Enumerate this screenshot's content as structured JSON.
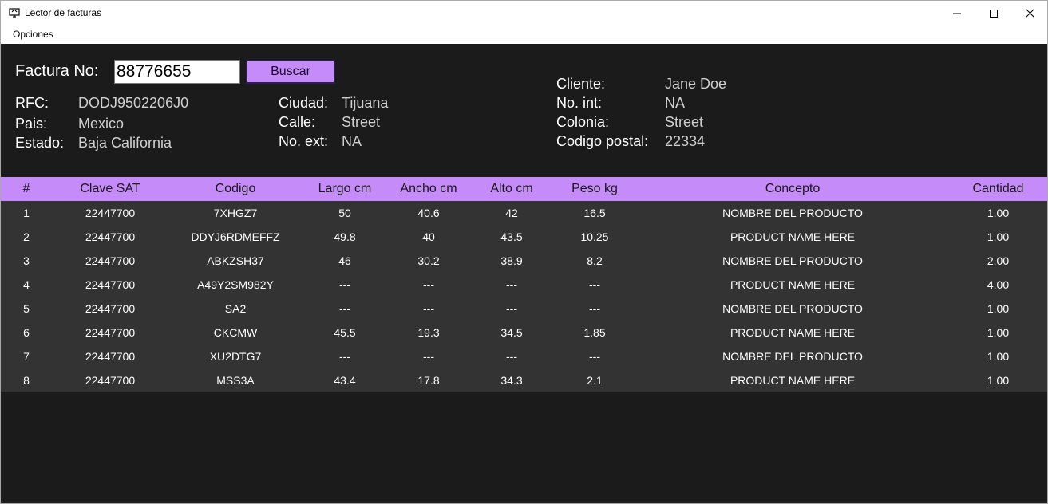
{
  "window": {
    "title": "Lector de facturas",
    "controls": {
      "minimize": "minimize-icon",
      "maximize": "maximize-icon",
      "close": "close-icon"
    }
  },
  "menu": {
    "items": [
      "Opciones"
    ]
  },
  "search": {
    "label": "Factura No:",
    "value": "88776655",
    "button_label": "Buscar"
  },
  "invoice": {
    "rfc_label": "RFC:",
    "rfc": "DODJ9502206J0",
    "pais_label": "Pais:",
    "pais": "Mexico",
    "estado_label": "Estado:",
    "estado": "Baja California",
    "ciudad_label": "Ciudad:",
    "ciudad": "Tijuana",
    "calle_label": "Calle:",
    "calle": "Street",
    "no_ext_label": "No. ext:",
    "no_ext": "NA",
    "cliente_label": "Cliente:",
    "cliente": "Jane Doe",
    "no_int_label": "No. int:",
    "no_int": "NA",
    "colonia_label": "Colonia:",
    "colonia": "Street",
    "cp_label": "Codigo postal:",
    "cp": "22334"
  },
  "table": {
    "columns": [
      "#",
      "Clave SAT",
      "Codigo",
      "Largo cm",
      "Ancho cm",
      "Alto cm",
      "Peso kg",
      "Concepto",
      "Cantidad"
    ],
    "rows": [
      [
        "1",
        "22447700",
        "7XHGZ7",
        "50",
        "40.6",
        "42",
        "16.5",
        "NOMBRE DEL PRODUCTO",
        "1.00"
      ],
      [
        "2",
        "22447700",
        "DDYJ6RDMEFFZ",
        "49.8",
        "40",
        "43.5",
        "10.25",
        "PRODUCT NAME HERE",
        "1.00"
      ],
      [
        "3",
        "22447700",
        "ABKZSH37",
        "46",
        "30.2",
        "38.9",
        "8.2",
        "NOMBRE DEL PRODUCTO",
        "2.00"
      ],
      [
        "4",
        "22447700",
        "A49Y2SM982Y",
        "---",
        "---",
        "---",
        "---",
        "PRODUCT NAME HERE",
        "4.00"
      ],
      [
        "5",
        "22447700",
        "SA2",
        "---",
        "---",
        "---",
        "---",
        "NOMBRE DEL PRODUCTO",
        "1.00"
      ],
      [
        "6",
        "22447700",
        "CKCMW",
        "45.5",
        "19.3",
        "34.5",
        "1.85",
        "PRODUCT NAME HERE",
        "1.00"
      ],
      [
        "7",
        "22447700",
        "XU2DTG7",
        "---",
        "---",
        "---",
        "---",
        "NOMBRE DEL PRODUCTO",
        "1.00"
      ],
      [
        "8",
        "22447700",
        "MSS3A",
        "43.4",
        "17.8",
        "34.3",
        "2.1",
        "PRODUCT NAME HERE",
        "1.00"
      ]
    ]
  },
  "colors": {
    "accent": "#c58bf8",
    "background": "#1b1b1b",
    "row_background": "#333333"
  }
}
